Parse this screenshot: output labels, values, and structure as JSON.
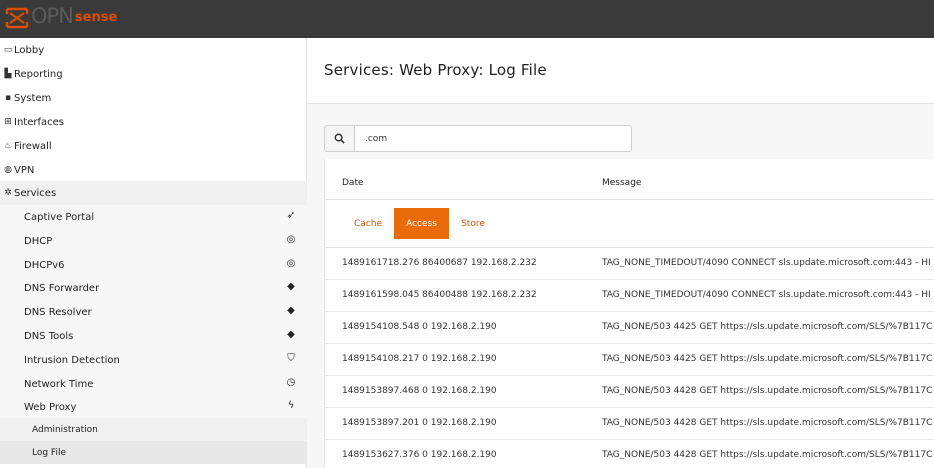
{
  "brand": {
    "logo_main": "OPN",
    "logo_sub": "sense"
  },
  "sidebar": {
    "items": [
      {
        "label": "Lobby",
        "icon": "laptop-icon"
      },
      {
        "label": "Reporting",
        "icon": "chart-icon"
      },
      {
        "label": "System",
        "icon": "computer-icon"
      },
      {
        "label": "Interfaces",
        "icon": "sitemap-icon"
      },
      {
        "label": "Firewall",
        "icon": "fire-icon"
      },
      {
        "label": "VPN",
        "icon": "globe-icon"
      },
      {
        "label": "Services",
        "icon": "cog-icon"
      }
    ],
    "services_sub": [
      {
        "label": "Captive Portal",
        "icon": "paper-plane-icon"
      },
      {
        "label": "DHCP",
        "icon": "bullseye-icon"
      },
      {
        "label": "DHCPv6",
        "icon": "bullseye-icon"
      },
      {
        "label": "DNS Forwarder",
        "icon": "tags-icon"
      },
      {
        "label": "DNS Resolver",
        "icon": "tags-icon"
      },
      {
        "label": "DNS Tools",
        "icon": "tags-icon"
      },
      {
        "label": "Intrusion Detection",
        "icon": "shield-icon"
      },
      {
        "label": "Network Time",
        "icon": "clock-icon"
      },
      {
        "label": "Web Proxy",
        "icon": "bolt-icon"
      }
    ],
    "webproxy_sub": [
      {
        "label": "Administration"
      },
      {
        "label": "Log File"
      }
    ]
  },
  "page": {
    "title": "Services: Web Proxy: Log File"
  },
  "search": {
    "value": ".com"
  },
  "table": {
    "columns": [
      "Date",
      "Message"
    ],
    "tabs": [
      {
        "label": "Cache",
        "active": false
      },
      {
        "label": "Access",
        "active": true
      },
      {
        "label": "Store",
        "active": false
      }
    ],
    "rows": [
      {
        "date": "1489161718.276 86400687 192.168.2.232",
        "message": "TAG_NONE_TIMEDOUT/4090 CONNECT sls.update.microsoft.com:443 - HI"
      },
      {
        "date": "1489161598.045 86400488 192.168.2.232",
        "message": "TAG_NONE_TIMEDOUT/4090 CONNECT sls.update.microsoft.com:443 - HI"
      },
      {
        "date": "1489154108.548 0 192.168.2.190",
        "message": "TAG_NONE/503 4425 GET https://sls.update.microsoft.com/SLS/%7B117C"
      },
      {
        "date": "1489154108.217 0 192.168.2.190",
        "message": "TAG_NONE/503 4425 GET https://sls.update.microsoft.com/SLS/%7B117C"
      },
      {
        "date": "1489153897.468 0 192.168.2.190",
        "message": "TAG_NONE/503 4428 GET https://sls.update.microsoft.com/SLS/%7B117C"
      },
      {
        "date": "1489153897.201 0 192.168.2.190",
        "message": "TAG_NONE/503 4428 GET https://sls.update.microsoft.com/SLS/%7B117C"
      },
      {
        "date": "1489153627.376 0 192.168.2.190",
        "message": "TAG_NONE/503 4428 GET https://sls.update.microsoft.com/SLS/%7B117C"
      }
    ]
  }
}
